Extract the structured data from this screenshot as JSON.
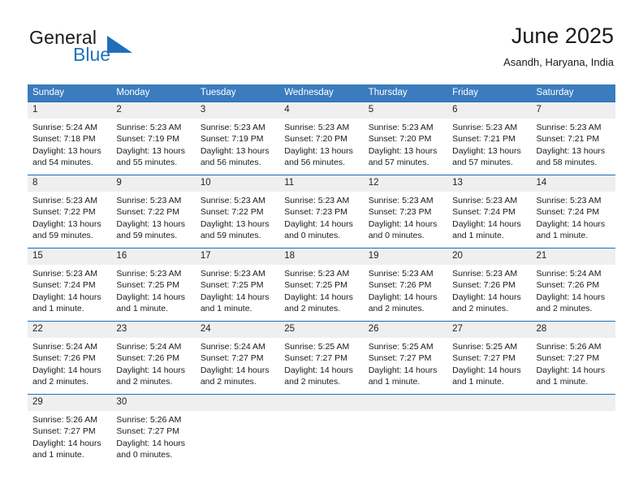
{
  "brand": {
    "name_top": "General",
    "name_bottom": "Blue",
    "accent_color": "#1f6fb8"
  },
  "header": {
    "title": "June 2025",
    "location": "Asandh, Haryana, India"
  },
  "theme": {
    "header_row_bg": "#3a7cbe",
    "day_number_bg": "#efefef",
    "cell_border": "#1f6fb8",
    "text_color": "#1a1a1a"
  },
  "weekday_headers": [
    "Sunday",
    "Monday",
    "Tuesday",
    "Wednesday",
    "Thursday",
    "Friday",
    "Saturday"
  ],
  "weeks": [
    [
      {
        "day": "1",
        "sunrise": "Sunrise: 5:24 AM",
        "sunset": "Sunset: 7:18 PM",
        "daylight_line1": "Daylight: 13 hours",
        "daylight_line2": "and 54 minutes."
      },
      {
        "day": "2",
        "sunrise": "Sunrise: 5:23 AM",
        "sunset": "Sunset: 7:19 PM",
        "daylight_line1": "Daylight: 13 hours",
        "daylight_line2": "and 55 minutes."
      },
      {
        "day": "3",
        "sunrise": "Sunrise: 5:23 AM",
        "sunset": "Sunset: 7:19 PM",
        "daylight_line1": "Daylight: 13 hours",
        "daylight_line2": "and 56 minutes."
      },
      {
        "day": "4",
        "sunrise": "Sunrise: 5:23 AM",
        "sunset": "Sunset: 7:20 PM",
        "daylight_line1": "Daylight: 13 hours",
        "daylight_line2": "and 56 minutes."
      },
      {
        "day": "5",
        "sunrise": "Sunrise: 5:23 AM",
        "sunset": "Sunset: 7:20 PM",
        "daylight_line1": "Daylight: 13 hours",
        "daylight_line2": "and 57 minutes."
      },
      {
        "day": "6",
        "sunrise": "Sunrise: 5:23 AM",
        "sunset": "Sunset: 7:21 PM",
        "daylight_line1": "Daylight: 13 hours",
        "daylight_line2": "and 57 minutes."
      },
      {
        "day": "7",
        "sunrise": "Sunrise: 5:23 AM",
        "sunset": "Sunset: 7:21 PM",
        "daylight_line1": "Daylight: 13 hours",
        "daylight_line2": "and 58 minutes."
      }
    ],
    [
      {
        "day": "8",
        "sunrise": "Sunrise: 5:23 AM",
        "sunset": "Sunset: 7:22 PM",
        "daylight_line1": "Daylight: 13 hours",
        "daylight_line2": "and 59 minutes."
      },
      {
        "day": "9",
        "sunrise": "Sunrise: 5:23 AM",
        "sunset": "Sunset: 7:22 PM",
        "daylight_line1": "Daylight: 13 hours",
        "daylight_line2": "and 59 minutes."
      },
      {
        "day": "10",
        "sunrise": "Sunrise: 5:23 AM",
        "sunset": "Sunset: 7:22 PM",
        "daylight_line1": "Daylight: 13 hours",
        "daylight_line2": "and 59 minutes."
      },
      {
        "day": "11",
        "sunrise": "Sunrise: 5:23 AM",
        "sunset": "Sunset: 7:23 PM",
        "daylight_line1": "Daylight: 14 hours",
        "daylight_line2": "and 0 minutes."
      },
      {
        "day": "12",
        "sunrise": "Sunrise: 5:23 AM",
        "sunset": "Sunset: 7:23 PM",
        "daylight_line1": "Daylight: 14 hours",
        "daylight_line2": "and 0 minutes."
      },
      {
        "day": "13",
        "sunrise": "Sunrise: 5:23 AM",
        "sunset": "Sunset: 7:24 PM",
        "daylight_line1": "Daylight: 14 hours",
        "daylight_line2": "and 1 minute."
      },
      {
        "day": "14",
        "sunrise": "Sunrise: 5:23 AM",
        "sunset": "Sunset: 7:24 PM",
        "daylight_line1": "Daylight: 14 hours",
        "daylight_line2": "and 1 minute."
      }
    ],
    [
      {
        "day": "15",
        "sunrise": "Sunrise: 5:23 AM",
        "sunset": "Sunset: 7:24 PM",
        "daylight_line1": "Daylight: 14 hours",
        "daylight_line2": "and 1 minute."
      },
      {
        "day": "16",
        "sunrise": "Sunrise: 5:23 AM",
        "sunset": "Sunset: 7:25 PM",
        "daylight_line1": "Daylight: 14 hours",
        "daylight_line2": "and 1 minute."
      },
      {
        "day": "17",
        "sunrise": "Sunrise: 5:23 AM",
        "sunset": "Sunset: 7:25 PM",
        "daylight_line1": "Daylight: 14 hours",
        "daylight_line2": "and 1 minute."
      },
      {
        "day": "18",
        "sunrise": "Sunrise: 5:23 AM",
        "sunset": "Sunset: 7:25 PM",
        "daylight_line1": "Daylight: 14 hours",
        "daylight_line2": "and 2 minutes."
      },
      {
        "day": "19",
        "sunrise": "Sunrise: 5:23 AM",
        "sunset": "Sunset: 7:26 PM",
        "daylight_line1": "Daylight: 14 hours",
        "daylight_line2": "and 2 minutes."
      },
      {
        "day": "20",
        "sunrise": "Sunrise: 5:23 AM",
        "sunset": "Sunset: 7:26 PM",
        "daylight_line1": "Daylight: 14 hours",
        "daylight_line2": "and 2 minutes."
      },
      {
        "day": "21",
        "sunrise": "Sunrise: 5:24 AM",
        "sunset": "Sunset: 7:26 PM",
        "daylight_line1": "Daylight: 14 hours",
        "daylight_line2": "and 2 minutes."
      }
    ],
    [
      {
        "day": "22",
        "sunrise": "Sunrise: 5:24 AM",
        "sunset": "Sunset: 7:26 PM",
        "daylight_line1": "Daylight: 14 hours",
        "daylight_line2": "and 2 minutes."
      },
      {
        "day": "23",
        "sunrise": "Sunrise: 5:24 AM",
        "sunset": "Sunset: 7:26 PM",
        "daylight_line1": "Daylight: 14 hours",
        "daylight_line2": "and 2 minutes."
      },
      {
        "day": "24",
        "sunrise": "Sunrise: 5:24 AM",
        "sunset": "Sunset: 7:27 PM",
        "daylight_line1": "Daylight: 14 hours",
        "daylight_line2": "and 2 minutes."
      },
      {
        "day": "25",
        "sunrise": "Sunrise: 5:25 AM",
        "sunset": "Sunset: 7:27 PM",
        "daylight_line1": "Daylight: 14 hours",
        "daylight_line2": "and 2 minutes."
      },
      {
        "day": "26",
        "sunrise": "Sunrise: 5:25 AM",
        "sunset": "Sunset: 7:27 PM",
        "daylight_line1": "Daylight: 14 hours",
        "daylight_line2": "and 1 minute."
      },
      {
        "day": "27",
        "sunrise": "Sunrise: 5:25 AM",
        "sunset": "Sunset: 7:27 PM",
        "daylight_line1": "Daylight: 14 hours",
        "daylight_line2": "and 1 minute."
      },
      {
        "day": "28",
        "sunrise": "Sunrise: 5:26 AM",
        "sunset": "Sunset: 7:27 PM",
        "daylight_line1": "Daylight: 14 hours",
        "daylight_line2": "and 1 minute."
      }
    ],
    [
      {
        "day": "29",
        "sunrise": "Sunrise: 5:26 AM",
        "sunset": "Sunset: 7:27 PM",
        "daylight_line1": "Daylight: 14 hours",
        "daylight_line2": "and 1 minute."
      },
      {
        "day": "30",
        "sunrise": "Sunrise: 5:26 AM",
        "sunset": "Sunset: 7:27 PM",
        "daylight_line1": "Daylight: 14 hours",
        "daylight_line2": "and 0 minutes."
      },
      {
        "day": "",
        "sunrise": "",
        "sunset": "",
        "daylight_line1": "",
        "daylight_line2": ""
      },
      {
        "day": "",
        "sunrise": "",
        "sunset": "",
        "daylight_line1": "",
        "daylight_line2": ""
      },
      {
        "day": "",
        "sunrise": "",
        "sunset": "",
        "daylight_line1": "",
        "daylight_line2": ""
      },
      {
        "day": "",
        "sunrise": "",
        "sunset": "",
        "daylight_line1": "",
        "daylight_line2": ""
      },
      {
        "day": "",
        "sunrise": "",
        "sunset": "",
        "daylight_line1": "",
        "daylight_line2": ""
      }
    ]
  ]
}
